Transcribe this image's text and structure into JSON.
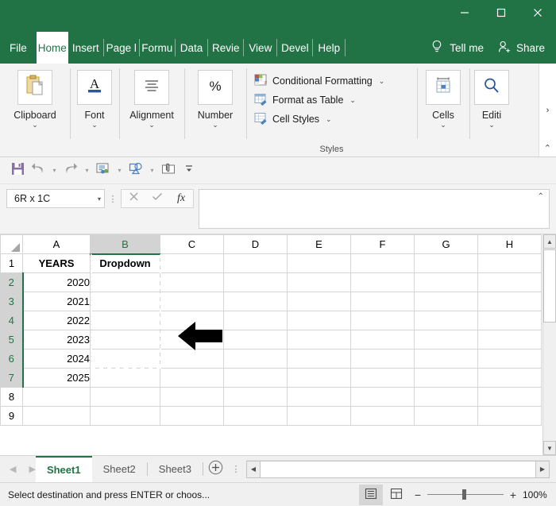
{
  "window": {
    "controls": [
      {
        "name": "minimize",
        "glyph": "minimize-icon"
      },
      {
        "name": "maximize",
        "glyph": "maximize-icon"
      },
      {
        "name": "close",
        "glyph": "close-icon"
      }
    ]
  },
  "ribbon_tabs": {
    "items": [
      {
        "label": "File",
        "active": false
      },
      {
        "label": "Home",
        "active": true
      },
      {
        "label": "Insert",
        "active": false
      },
      {
        "label": "Page l",
        "active": false
      },
      {
        "label": "Formu",
        "active": false
      },
      {
        "label": "Data",
        "active": false
      },
      {
        "label": "Revie",
        "active": false
      },
      {
        "label": "View",
        "active": false
      },
      {
        "label": "Devel",
        "active": false
      },
      {
        "label": "Help",
        "active": false
      }
    ],
    "tell_me": "Tell me",
    "tell_me_icon": "lightbulb-icon",
    "share": "Share",
    "share_icon": "person-add-icon"
  },
  "ribbon": {
    "groups": [
      {
        "label": "Clipboard",
        "icon": "clipboard-icon"
      },
      {
        "label": "Font",
        "icon": "font-a-icon"
      },
      {
        "label": "Alignment",
        "icon": "alignment-icon"
      },
      {
        "label": "Number",
        "icon": "percent-icon"
      }
    ],
    "styles": {
      "group_name": "Styles",
      "items": [
        {
          "label": "Conditional Formatting",
          "icon": "conditional-formatting-icon"
        },
        {
          "label": "Format as Table",
          "icon": "format-as-table-icon"
        },
        {
          "label": "Cell Styles",
          "icon": "cell-styles-icon"
        }
      ]
    },
    "cells": {
      "label": "Cells",
      "icon": "cells-icon"
    },
    "editing": {
      "label": "Editi",
      "icon": "find-magnifier-icon"
    },
    "overflow_chevron": "›",
    "collapse_caret": "⌃",
    "dropdown_caret": "⌄"
  },
  "quick_access": {
    "buttons": [
      {
        "name": "save-icon"
      },
      {
        "name": "undo-icon"
      },
      {
        "name": "redo-icon"
      },
      {
        "name": "email-recipients-icon"
      },
      {
        "name": "shapes-icon"
      },
      {
        "name": "attachment-icon"
      },
      {
        "name": "customize-qat-icon"
      }
    ]
  },
  "formula_bar": {
    "name_box_value": "6R x 1C",
    "name_box_caret": "▾",
    "cancel_icon": "cancel-x-icon",
    "enter_icon": "enter-check-icon",
    "fx_label": "fx",
    "formula_value": "",
    "collapse_icon": "collapse-formula-bar-icon"
  },
  "grid": {
    "columns": [
      "A",
      "B",
      "C",
      "D",
      "E",
      "F",
      "G",
      "H"
    ],
    "selected_column": "B",
    "rows": [
      1,
      2,
      3,
      4,
      5,
      6,
      7,
      8,
      9
    ],
    "selected_rows": [
      2,
      3,
      4,
      5,
      6,
      7
    ],
    "cells": {
      "A1": "YEARS",
      "B1": "Dropdown",
      "A2": "2020",
      "A3": "2021",
      "A4": "2022",
      "A5": "2023",
      "A6": "2024",
      "A7": "2025"
    },
    "selection_range": "B2:B7",
    "active_cell": "B2",
    "annotation": {
      "name": "left-arrow-annotation",
      "color": "#000000"
    }
  },
  "sheet_tabs": {
    "prev_icon": "nav-prev-icon",
    "next_icon": "nav-next-icon",
    "tabs": [
      {
        "label": "Sheet1",
        "active": true
      },
      {
        "label": "Sheet2",
        "active": false
      },
      {
        "label": "Sheet3",
        "active": false
      }
    ],
    "add_sheet_icon": "add-sheet-plus-icon",
    "options_icon": "tab-options-icon"
  },
  "status_bar": {
    "message": "Select destination and press ENTER or choos...",
    "views": [
      {
        "name": "normal-view-icon",
        "active": true
      },
      {
        "name": "page-layout-view-icon",
        "active": false
      },
      {
        "name": "page-break-view-icon",
        "active": false
      }
    ],
    "zoom_out": "−",
    "zoom_in": "+",
    "zoom_level": "100%"
  },
  "colors": {
    "brand_green": "#217346",
    "selection_fill": "#c8c8c8",
    "header_gray": "#e6e6e6"
  }
}
